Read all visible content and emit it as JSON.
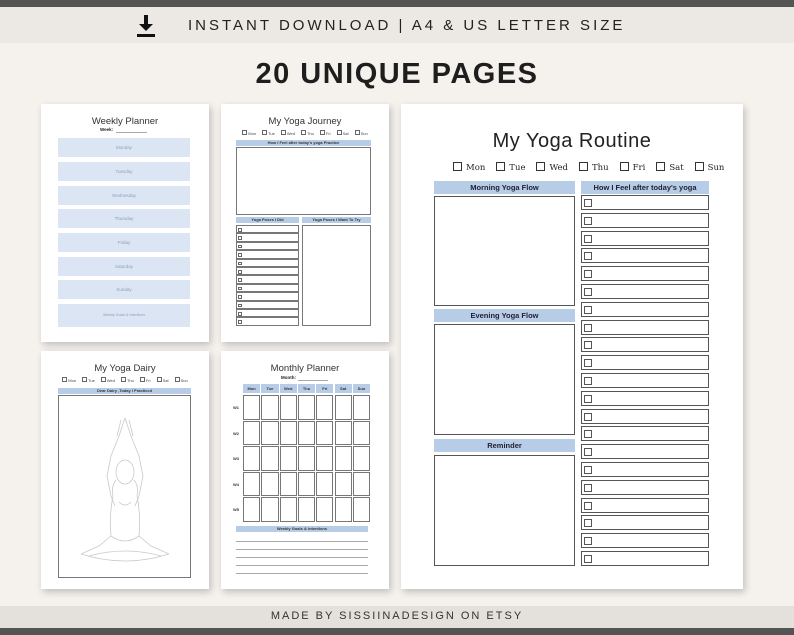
{
  "header": {
    "download_icon": "download-icon",
    "text": "INSTANT DOWNLOAD | A4 & US LETTER SIZE"
  },
  "main_title": "20 UNIQUE PAGES",
  "footer": {
    "text": "MADE BY SISSIINADESIGN ON ETSY"
  },
  "weekly_planner": {
    "title": "Weekly Planner",
    "week_label": "Week:",
    "days": [
      "Monday",
      "Tuesday",
      "Wednesday",
      "Thursday",
      "Friday",
      "Saturday",
      "Sunday",
      "Weekly Goals & Intentions"
    ]
  },
  "yoga_journey": {
    "title": "My Yoga Journey",
    "days": [
      "Mon",
      "Tue",
      "Wed",
      "Thu",
      "Fri",
      "Sat",
      "Sun"
    ],
    "feel_header": "How I Feel after today's yoga Practice",
    "did_header": "Yoga Poses I Did",
    "try_header": "Yoga Poses I Want To Try"
  },
  "yoga_dairy": {
    "title": "My Yoga Dairy",
    "days": [
      "Mon",
      "Tue",
      "Wed",
      "Thu",
      "Fri",
      "Sat",
      "Sun"
    ],
    "header": "Dear Dairy ,Today I Practiced",
    "illustration_icon": "meditating-figure-icon"
  },
  "monthly_planner": {
    "title": "Monthly Planner",
    "month_label": "Month:",
    "days": [
      "Mon",
      "Tue",
      "Wed",
      "Thu",
      "Fri",
      "Sat",
      "Sun"
    ],
    "weeks": [
      "W1",
      "W2",
      "W3",
      "W4",
      "W5"
    ],
    "goals_header": "Weekly Goals & Intentions"
  },
  "yoga_routine": {
    "title": "My Yoga Routine",
    "days": [
      "Mon",
      "Tue",
      "Wed",
      "Thu",
      "Fri",
      "Sat",
      "Sun"
    ],
    "morning_header": "Morning Yoga Flow",
    "evening_header": "Evening Yoga Flow",
    "reminder_header": "Reminder",
    "feel_header": "How I Feel after today's yoga"
  }
}
